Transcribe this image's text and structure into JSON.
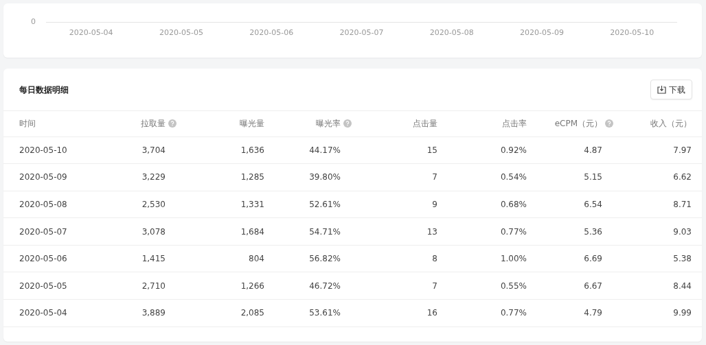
{
  "chart": {
    "y_tick": "0",
    "x_labels": [
      "2020-05-04",
      "2020-05-05",
      "2020-05-06",
      "2020-05-07",
      "2020-05-08",
      "2020-05-09",
      "2020-05-10"
    ]
  },
  "detail": {
    "title": "每日数据明细",
    "download_button": "下载",
    "columns": [
      {
        "label": "时间",
        "help": false
      },
      {
        "label": "拉取量",
        "help": true
      },
      {
        "label": "曝光量",
        "help": false
      },
      {
        "label": "曝光率",
        "help": true
      },
      {
        "label": "点击量",
        "help": false
      },
      {
        "label": "点击率",
        "help": false
      },
      {
        "label": "eCPM（元）",
        "help": true
      },
      {
        "label": "收入（元）",
        "help": false
      }
    ],
    "rows": [
      [
        "2020-05-10",
        "3,704",
        "1,636",
        "44.17%",
        "15",
        "0.92%",
        "4.87",
        "7.97"
      ],
      [
        "2020-05-09",
        "3,229",
        "1,285",
        "39.80%",
        "7",
        "0.54%",
        "5.15",
        "6.62"
      ],
      [
        "2020-05-08",
        "2,530",
        "1,331",
        "52.61%",
        "9",
        "0.68%",
        "6.54",
        "8.71"
      ],
      [
        "2020-05-07",
        "3,078",
        "1,684",
        "54.71%",
        "13",
        "0.77%",
        "5.36",
        "9.03"
      ],
      [
        "2020-05-06",
        "1,415",
        "804",
        "56.82%",
        "8",
        "1.00%",
        "6.69",
        "5.38"
      ],
      [
        "2020-05-05",
        "2,710",
        "1,266",
        "46.72%",
        "7",
        "0.55%",
        "6.67",
        "8.44"
      ],
      [
        "2020-05-04",
        "3,889",
        "2,085",
        "53.61%",
        "16",
        "0.77%",
        "4.79",
        "9.99"
      ]
    ]
  }
}
